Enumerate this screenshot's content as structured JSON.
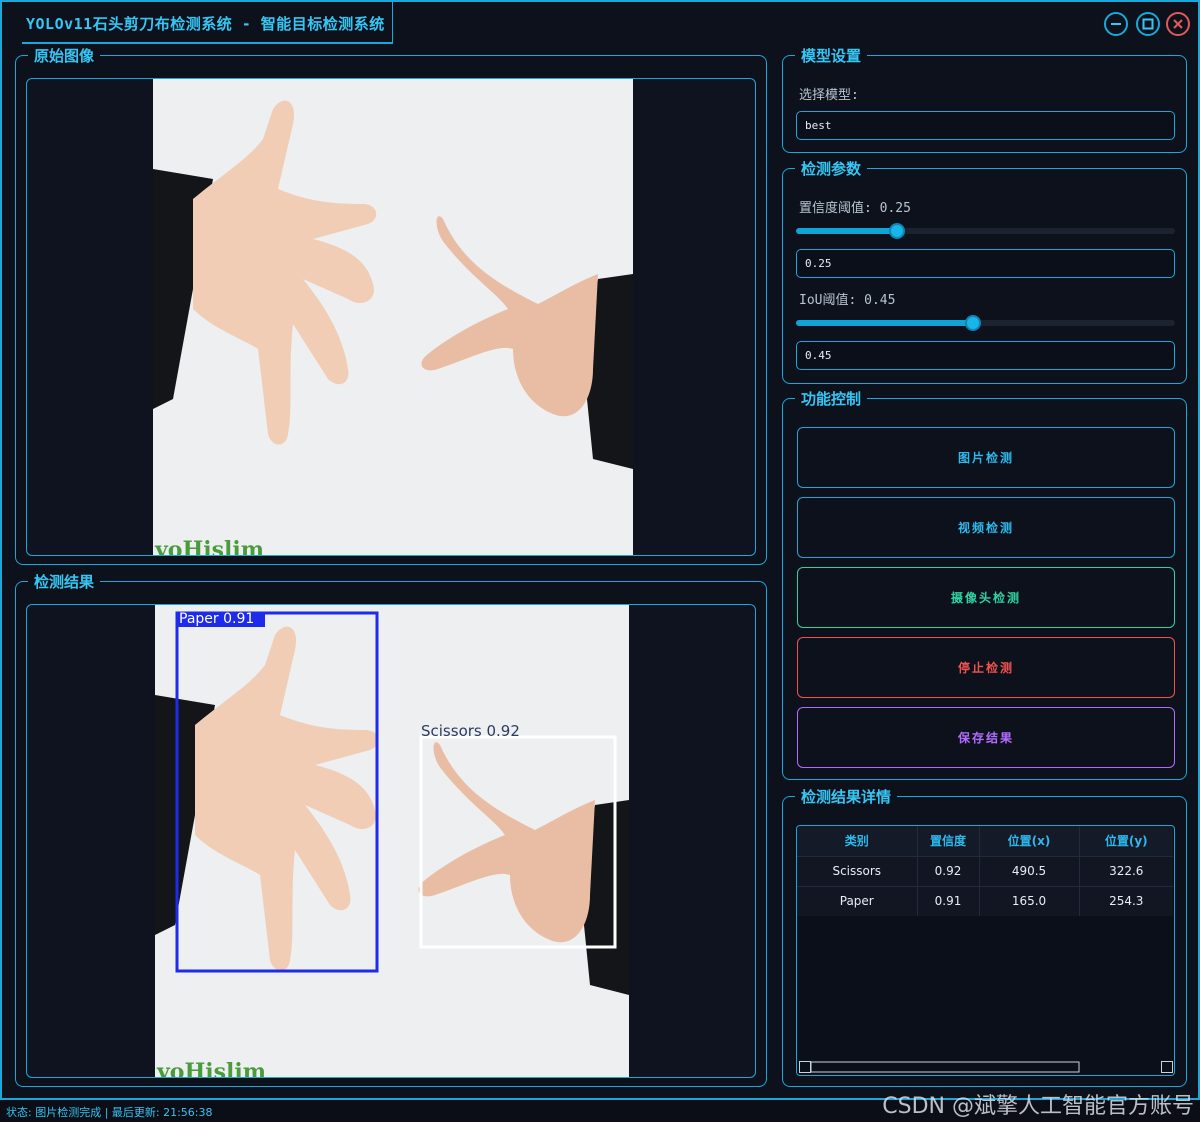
{
  "window": {
    "title": "YOLOv11石头剪刀布检测系统 - 智能目标检测系统"
  },
  "panels": {
    "original": {
      "title": "原始图像",
      "watermark_text": "yoHislim"
    },
    "result": {
      "title": "检测结果",
      "detections": [
        {
          "label": "Paper 0.91",
          "color": "#1f2bea"
        },
        {
          "label": "Scissors 0.92",
          "color": "#ffffff"
        }
      ]
    }
  },
  "model_settings": {
    "title": "模型设置",
    "select_label": "选择模型:",
    "model_value": "best"
  },
  "detect_params": {
    "title": "检测参数",
    "confidence_label": "置信度阈值: 0.25",
    "confidence_value": "0.25",
    "confidence_level": 0.25,
    "iou_label": "IoU阈值: 0.45",
    "iou_value": "0.45",
    "iou_level": 0.45
  },
  "controls": {
    "title": "功能控制",
    "image_detect": "图片检测",
    "video_detect": "视频检测",
    "camera_detect": "摄像头检测",
    "stop_detect": "停止检测",
    "save_result": "保存结果",
    "colors": {
      "image": "#2eb8ec",
      "video": "#2eb8ec",
      "camera": "#2fd3a0",
      "stop": "#ef5350",
      "save": "#b26bff"
    }
  },
  "results_detail": {
    "title": "检测结果详情",
    "columns": [
      "类别",
      "置信度",
      "位置(x)",
      "位置(y)"
    ],
    "rows": [
      [
        "Scissors",
        "0.92",
        "490.5",
        "322.6"
      ],
      [
        "Paper",
        "0.91",
        "165.0",
        "254.3"
      ]
    ]
  },
  "status_bar": {
    "text": "状态: 图片检测完成 | 最后更新: 21:56:38"
  },
  "overlay": {
    "watermark": "CSDN @斌擎人工智能官方账号"
  }
}
